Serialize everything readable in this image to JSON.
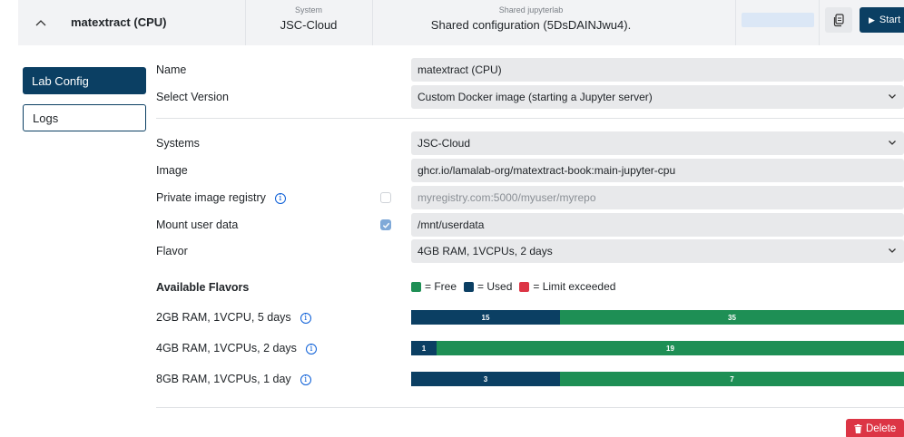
{
  "header": {
    "name": "matextract (CPU)",
    "system_caption": "System",
    "system_value": "JSC-Cloud",
    "shared_caption": "Shared jupyterlab",
    "shared_value": "Shared configuration (5DsDAINJwu4).",
    "start_label": "Start"
  },
  "nav": {
    "lab_config": "Lab Config",
    "logs": "Logs"
  },
  "form": {
    "name_label": "Name",
    "name_value": "matextract (CPU)",
    "version_label": "Select Version",
    "version_value": "Custom Docker image (starting a Jupyter server)",
    "systems_label": "Systems",
    "systems_value": "JSC-Cloud",
    "image_label": "Image",
    "image_value": "ghcr.io/lamalab-org/matextract-book:main-jupyter-cpu",
    "registry_label": "Private image registry",
    "registry_placeholder": "myregistry.com:5000/myuser/myrepo",
    "mount_label": "Mount user data",
    "mount_value": "/mnt/userdata",
    "flavor_label": "Flavor",
    "flavor_value": "4GB RAM, 1VCPUs, 2 days"
  },
  "flavors": {
    "title": "Available Flavors",
    "legend_free": "= Free",
    "legend_used": "= Used",
    "legend_limit": "= Limit exceeded",
    "rows": [
      {
        "label": "2GB RAM, 1VCPU, 5 days",
        "used": "15",
        "free": "35"
      },
      {
        "label": "4GB RAM, 1VCPUs, 2 days",
        "used": "1",
        "free": "19"
      },
      {
        "label": "8GB RAM, 1VCPUs, 1 day",
        "used": "3",
        "free": "7"
      }
    ]
  },
  "delete_label": "Delete",
  "colors": {
    "primary": "#0b3f63",
    "free": "#1e8f55",
    "limit": "#dc3545"
  },
  "checkboxes": {
    "private_registry_checked": false,
    "mount_user_data_checked": true
  }
}
